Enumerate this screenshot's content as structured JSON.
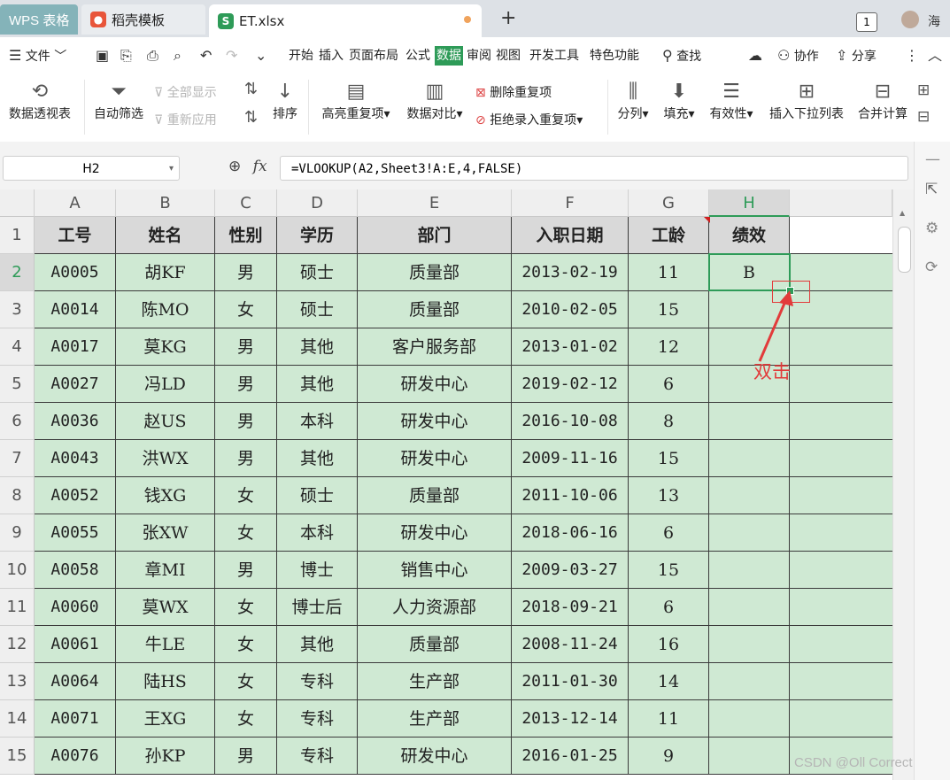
{
  "tabs": [
    {
      "label": "WPS 表格"
    },
    {
      "label": "稻壳模板"
    },
    {
      "label": "ET.xlsx"
    }
  ],
  "window": {
    "badge": "1",
    "user": "海"
  },
  "menu": {
    "file": "文件",
    "items": [
      "开始",
      "插入",
      "页面布局",
      "公式",
      "数据",
      "审阅",
      "视图",
      "开发工具",
      "特色功能"
    ],
    "active": "数据",
    "search": "查找",
    "collab": "协作",
    "share": "分享"
  },
  "ribbon": {
    "pivot": "数据透视表",
    "autofilter": "自动筛选",
    "show_all": "全部显示",
    "reapply": "重新应用",
    "sort": "排序",
    "highlight_dup": "高亮重复项",
    "compare": "数据对比",
    "delete_dup": "删除重复项",
    "reject_dup": "拒绝录入重复项",
    "split": "分列",
    "fill": "填充",
    "validation": "有效性",
    "insert_dropdown": "插入下拉列表",
    "consolidate": "合并计算"
  },
  "formula_bar": {
    "name_box": "H2",
    "fx": "fx",
    "formula": "=VLOOKUP(A2,Sheet3!A:E,4,FALSE)"
  },
  "grid": {
    "columns": [
      "A",
      "B",
      "C",
      "D",
      "E",
      "F",
      "G",
      "H"
    ],
    "selected_column": "H",
    "selected_row": "2",
    "rows": [
      {
        "n": "1",
        "cells": [
          "工号",
          "姓名",
          "性别",
          "学历",
          "部门",
          "入职日期",
          "工龄",
          "绩效"
        ]
      },
      {
        "n": "2",
        "cells": [
          "A0005",
          "胡KF",
          "男",
          "硕士",
          "质量部",
          "2013-02-19",
          "11",
          "B"
        ]
      },
      {
        "n": "3",
        "cells": [
          "A0014",
          "陈MO",
          "女",
          "硕士",
          "质量部",
          "2010-02-05",
          "15",
          ""
        ]
      },
      {
        "n": "4",
        "cells": [
          "A0017",
          "莫KG",
          "男",
          "其他",
          "客户服务部",
          "2013-01-02",
          "12",
          ""
        ]
      },
      {
        "n": "5",
        "cells": [
          "A0027",
          "冯LD",
          "男",
          "其他",
          "研发中心",
          "2019-02-12",
          "6",
          ""
        ]
      },
      {
        "n": "6",
        "cells": [
          "A0036",
          "赵US",
          "男",
          "本科",
          "研发中心",
          "2016-10-08",
          "8",
          ""
        ]
      },
      {
        "n": "7",
        "cells": [
          "A0043",
          "洪WX",
          "男",
          "其他",
          "研发中心",
          "2009-11-16",
          "15",
          ""
        ]
      },
      {
        "n": "8",
        "cells": [
          "A0052",
          "钱XG",
          "女",
          "硕士",
          "质量部",
          "2011-10-06",
          "13",
          ""
        ]
      },
      {
        "n": "9",
        "cells": [
          "A0055",
          "张XW",
          "女",
          "本科",
          "研发中心",
          "2018-06-16",
          "6",
          ""
        ]
      },
      {
        "n": "10",
        "cells": [
          "A0058",
          "章MI",
          "男",
          "博士",
          "销售中心",
          "2009-03-27",
          "15",
          ""
        ]
      },
      {
        "n": "11",
        "cells": [
          "A0060",
          "莫WX",
          "女",
          "博士后",
          "人力资源部",
          "2018-09-21",
          "6",
          ""
        ]
      },
      {
        "n": "12",
        "cells": [
          "A0061",
          "牛LE",
          "女",
          "其他",
          "质量部",
          "2008-11-24",
          "16",
          ""
        ]
      },
      {
        "n": "13",
        "cells": [
          "A0064",
          "陆HS",
          "女",
          "专科",
          "生产部",
          "2011-01-30",
          "14",
          ""
        ]
      },
      {
        "n": "14",
        "cells": [
          "A0071",
          "王XG",
          "女",
          "专科",
          "生产部",
          "2013-12-14",
          "11",
          ""
        ]
      },
      {
        "n": "15",
        "cells": [
          "A0076",
          "孙KP",
          "男",
          "专科",
          "研发中心",
          "2016-01-25",
          "9",
          ""
        ]
      }
    ]
  },
  "annotation": {
    "label": "双击",
    "color": "#e23b3b"
  },
  "watermark": "CSDN @Oll Correct",
  "colors": {
    "accent": "#2e9b58",
    "cell_fill": "#cfe9d3",
    "header_fill": "#d9d9d9",
    "annotation": "#e23b3b"
  }
}
